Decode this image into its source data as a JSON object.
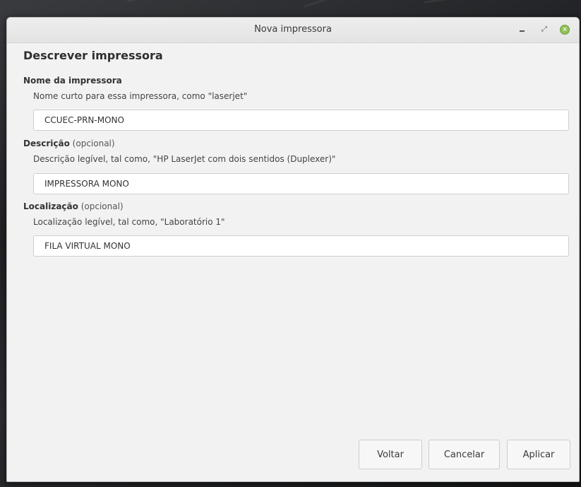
{
  "window": {
    "title": "Nova impressora",
    "controls": {
      "minimize_icon": "minimize-icon",
      "maximize_icon": "maximize-icon",
      "close_icon": "close-icon",
      "close_color": "#8fbf5a"
    }
  },
  "page": {
    "heading": "Descrever impressora"
  },
  "fields": {
    "name": {
      "label": "Nome da impressora",
      "hint": "Nome curto para essa impressora, como \"laserjet\"",
      "value": "CCUEC-PRN-MONO"
    },
    "description": {
      "label": "Descrição",
      "optional": "(opcional)",
      "hint": "Descrição legível, tal como, \"HP LaserJet com dois sentidos (Duplexer)\"",
      "value": "IMPRESSORA MONO"
    },
    "location": {
      "label": "Localização",
      "optional": "(opcional)",
      "hint": "Localização legível, tal como, \"Laboratório 1\"",
      "value": "FILA VIRTUAL MONO"
    }
  },
  "buttons": {
    "back": "Voltar",
    "cancel": "Cancelar",
    "apply": "Aplicar"
  }
}
